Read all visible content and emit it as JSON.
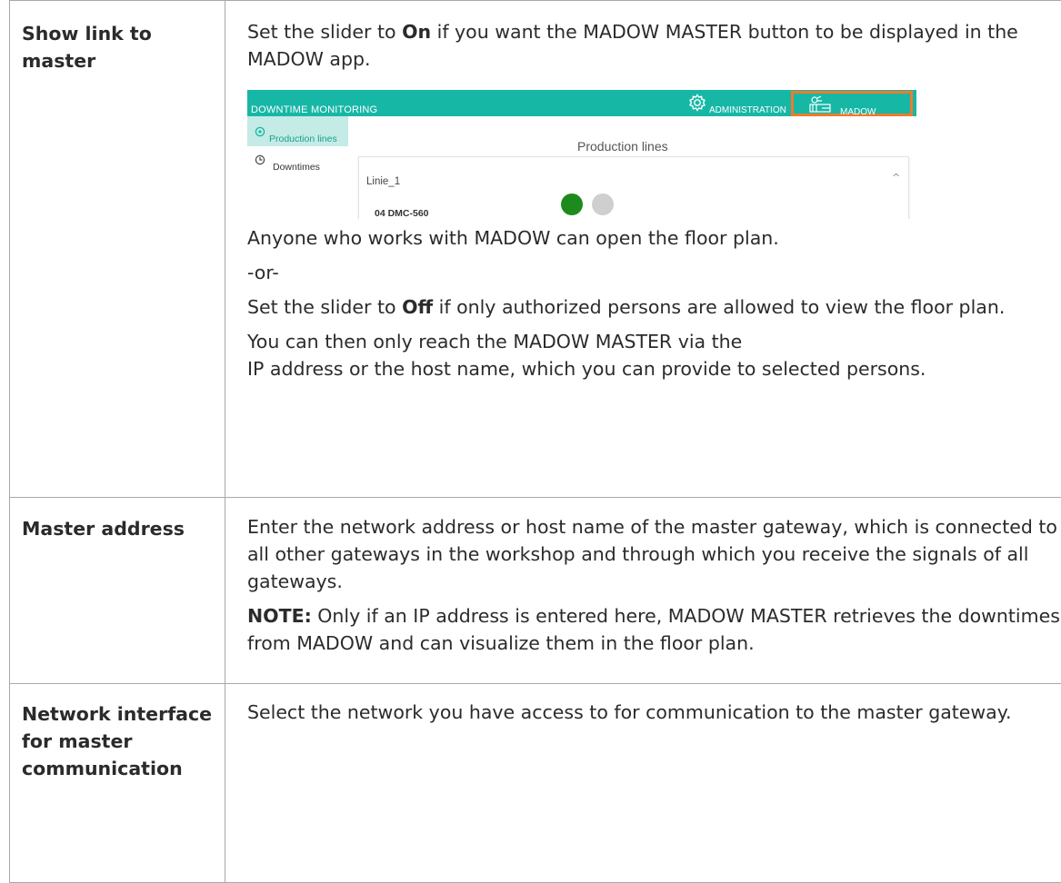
{
  "rows": [
    {
      "term": "Show link to master",
      "intro_a": "Set the slider to ",
      "intro_b": "On",
      "intro_c": " if you want the MADOW MASTER button to be displayed in the MADOW app.",
      "after_shot": "Anyone who works with MADOW can open the floor plan.",
      "or": "-or-",
      "off_a": "Set the slider to ",
      "off_b": "Off",
      "off_c": " if only authorized persons are allowed to view the floor plan.",
      "then_line1": "You can then only reach the MADOW MASTER via the",
      "then_line2": "IP address or the host name, which you can provide to selected persons."
    },
    {
      "term": "Master address",
      "text": "Enter the network address or host name of the master gateway, which is connected to all other gateways in the workshop and through which you receive the signals of all gateways.",
      "note_label": "NOTE:",
      "note_text": " Only if an IP address is entered here, MADOW MASTER retrieves the downtimes from MADOW and can visualize them in the floor plan."
    },
    {
      "term": "Network interface for master communication",
      "text": "Select the network you have access to for communication to the master gateway."
    }
  ],
  "screenshot": {
    "app_title": "DOWNTIME MONITORING",
    "admin_label": "ADMINISTRATION",
    "master_label": "MADOW MASTER",
    "sidebar": [
      {
        "label": "Production lines",
        "icon": "production-lines-icon",
        "active": true
      },
      {
        "label": "Downtimes",
        "icon": "clock-icon",
        "active": false
      }
    ],
    "content_title": "Production lines",
    "panel_name": "Linie_1",
    "panel_chevron": "^",
    "machine_name": "04 DMC-560",
    "status_dots": [
      "green",
      "grey"
    ],
    "colors": {
      "teal": "#17b7a6",
      "highlight": "#ee7b2b",
      "active_bg": "#c5ebe6",
      "dot_green": "#1e8a1e",
      "dot_grey": "#cfcfcf"
    }
  }
}
